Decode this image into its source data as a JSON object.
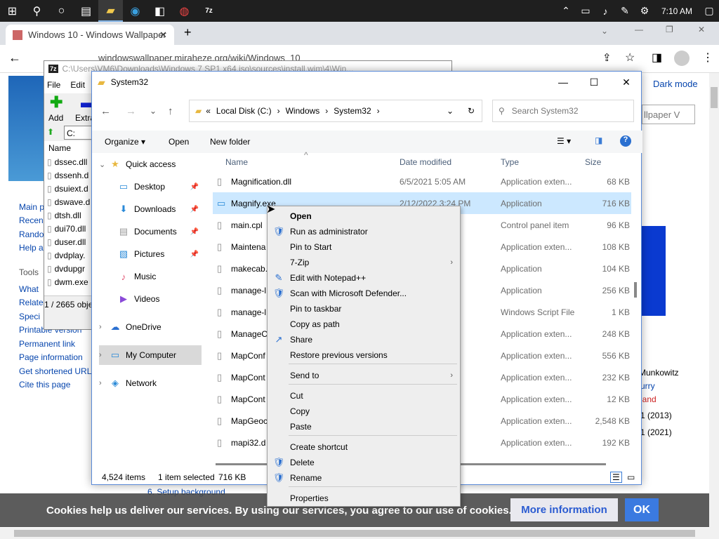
{
  "taskbar": {
    "clock": "7:10 AM"
  },
  "browser": {
    "tab_title": "Windows 10 - Windows Wallpaper",
    "url": "windowswallpaper.miraheze.org/wiki/Windows_10",
    "dark_mode": "Dark mode",
    "search_placeholder": "llpaper V"
  },
  "webpage": {
    "sidebar_links": [
      "Main p",
      "Recen",
      "Rando",
      "Help a"
    ],
    "tools_heading": "Tools",
    "tools_links": [
      "What",
      "Relate",
      "Speci",
      "Printable version",
      "Permanent link",
      "Page information",
      "Get shortened URL",
      "Cite this page"
    ],
    "right_texts": [
      "Munkowitz",
      "urry",
      "land",
      "1 (2013)",
      "1 (2021)"
    ],
    "setup_background": "6. Setup background",
    "cookie_text": "Cookies help us deliver our services. By using our services, you agree to our use of cookies.",
    "more_info": "More information",
    "ok": "OK"
  },
  "zip": {
    "title": "C:\\Users\\VM6\\Downloads\\Windows 7 SP1 x64.iso\\sources\\install.wim\\4\\Win...",
    "menu": [
      "File",
      "Edit"
    ],
    "tools": [
      "Add",
      "Extra"
    ],
    "path": "C:",
    "col_name": "Name",
    "files": [
      "dssec.dll",
      "dssenh.d",
      "dsuiext.d",
      "dswave.d",
      "dtsh.dll",
      "dui70.dll",
      "duser.dll",
      "dvdplay.",
      "dvdupgr",
      "dwm.exe"
    ],
    "status": "1 / 2665 obje"
  },
  "explorer": {
    "title": "System32",
    "breadcrumb": [
      "Local Disk (C:)",
      "Windows",
      "System32"
    ],
    "search_placeholder": "Search System32",
    "commands": [
      "Organize",
      "Open",
      "New folder"
    ],
    "columns": [
      "Name",
      "Date modified",
      "Type",
      "Size"
    ],
    "nav": [
      "Quick access",
      "Desktop",
      "Downloads",
      "Documents",
      "Pictures",
      "Music",
      "Videos",
      "OneDrive",
      "My Computer",
      "Network"
    ],
    "files": [
      {
        "name": "Magnification.dll",
        "date": "6/5/2021 5:05 AM",
        "type": "Application exten...",
        "size": "68 KB"
      },
      {
        "name": "Magnify.exe",
        "date": "2/12/2022 3:24 PM",
        "type": "Application",
        "size": "716 KB"
      },
      {
        "name": "main.cpl",
        "date": "M",
        "type": "Control panel item",
        "size": "96 KB"
      },
      {
        "name": "Maintena",
        "date": "M",
        "type": "Application exten...",
        "size": "108 KB"
      },
      {
        "name": "makecab.",
        "date": "M",
        "type": "Application",
        "size": "104 KB"
      },
      {
        "name": "manage-l",
        "date": "M",
        "type": "Application",
        "size": "256 KB"
      },
      {
        "name": "manage-l",
        "date": "M",
        "type": "Windows Script File",
        "size": "1 KB"
      },
      {
        "name": "ManageC",
        "date": "M",
        "type": "Application exten...",
        "size": "248 KB"
      },
      {
        "name": "MapConf",
        "date": "M",
        "type": "Application exten...",
        "size": "556 KB"
      },
      {
        "name": "MapCont",
        "date": "M",
        "type": "Application exten...",
        "size": "232 KB"
      },
      {
        "name": "MapCont",
        "date": "M",
        "type": "Application exten...",
        "size": "12 KB"
      },
      {
        "name": "MapGeoc",
        "date": "M",
        "type": "Application exten...",
        "size": "2,548 KB"
      },
      {
        "name": "mapi32.d",
        "date": "M",
        "type": "Application exten...",
        "size": "192 KB"
      }
    ],
    "status": {
      "items": "4,524 items",
      "selected": "1 item selected",
      "size": "716 KB"
    }
  },
  "context_menu": [
    "Open",
    "Run as administrator",
    "Pin to Start",
    "7-Zip",
    "Edit with Notepad++",
    "Scan with Microsoft Defender...",
    "Pin to taskbar",
    "Copy as path",
    "Share",
    "Restore previous versions",
    "Send to",
    "Cut",
    "Copy",
    "Paste",
    "Create shortcut",
    "Delete",
    "Rename",
    "Properties"
  ]
}
